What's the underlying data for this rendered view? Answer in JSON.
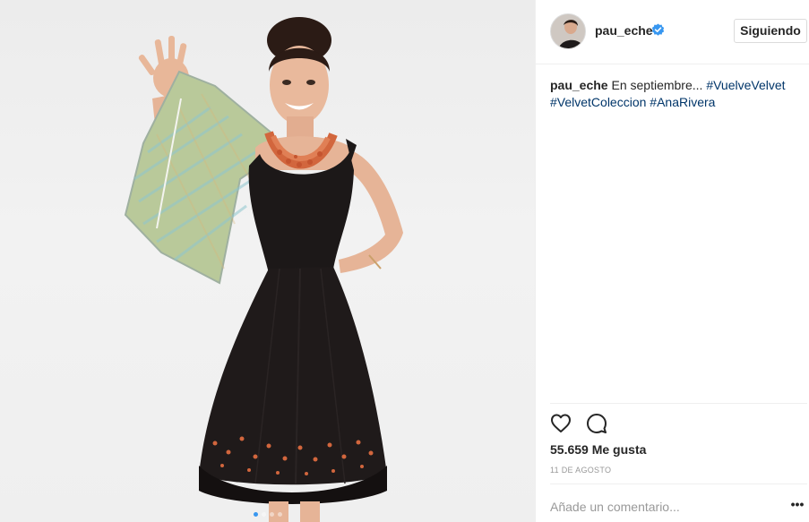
{
  "post": {
    "image_alt": "",
    "carousel": {
      "count": 4,
      "active_index": 0
    }
  },
  "header": {
    "username": "pau_eche",
    "verified_icon": "verified-badge-icon",
    "follow_label": "Siguiendo"
  },
  "caption": {
    "username": "pau_eche",
    "text": "En septiembre...",
    "hashtags": [
      "#VuelveVelvet",
      "#VelvetColeccion",
      "#AnaRivera"
    ]
  },
  "actions": {
    "like_icon": "heart-icon",
    "comment_icon": "comment-icon"
  },
  "likes": {
    "text": "55.659 Me gusta"
  },
  "date": {
    "text": "11 DE AGOSTO"
  },
  "comment": {
    "placeholder": "Añade un comentario...",
    "more_label": "•••"
  },
  "colors": {
    "verified": "#3897f0",
    "hashtag": "#003569",
    "dress": "#1c1818",
    "necklace": "#d2663d"
  }
}
